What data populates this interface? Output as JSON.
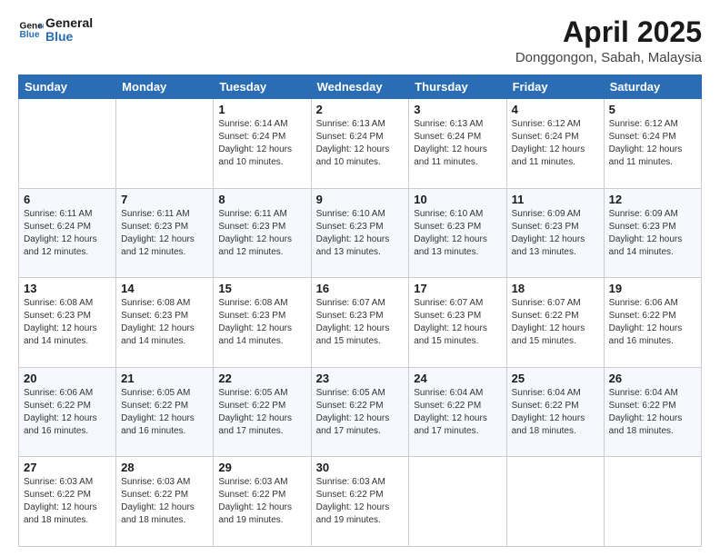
{
  "logo": {
    "line1": "General",
    "line2": "Blue"
  },
  "title": "April 2025",
  "subtitle": "Donggongon, Sabah, Malaysia",
  "weekdays": [
    "Sunday",
    "Monday",
    "Tuesday",
    "Wednesday",
    "Thursday",
    "Friday",
    "Saturday"
  ],
  "weeks": [
    [
      {
        "day": "",
        "info": ""
      },
      {
        "day": "",
        "info": ""
      },
      {
        "day": "1",
        "info": "Sunrise: 6:14 AM\nSunset: 6:24 PM\nDaylight: 12 hours and 10 minutes."
      },
      {
        "day": "2",
        "info": "Sunrise: 6:13 AM\nSunset: 6:24 PM\nDaylight: 12 hours and 10 minutes."
      },
      {
        "day": "3",
        "info": "Sunrise: 6:13 AM\nSunset: 6:24 PM\nDaylight: 12 hours and 11 minutes."
      },
      {
        "day": "4",
        "info": "Sunrise: 6:12 AM\nSunset: 6:24 PM\nDaylight: 12 hours and 11 minutes."
      },
      {
        "day": "5",
        "info": "Sunrise: 6:12 AM\nSunset: 6:24 PM\nDaylight: 12 hours and 11 minutes."
      }
    ],
    [
      {
        "day": "6",
        "info": "Sunrise: 6:11 AM\nSunset: 6:24 PM\nDaylight: 12 hours and 12 minutes."
      },
      {
        "day": "7",
        "info": "Sunrise: 6:11 AM\nSunset: 6:23 PM\nDaylight: 12 hours and 12 minutes."
      },
      {
        "day": "8",
        "info": "Sunrise: 6:11 AM\nSunset: 6:23 PM\nDaylight: 12 hours and 12 minutes."
      },
      {
        "day": "9",
        "info": "Sunrise: 6:10 AM\nSunset: 6:23 PM\nDaylight: 12 hours and 13 minutes."
      },
      {
        "day": "10",
        "info": "Sunrise: 6:10 AM\nSunset: 6:23 PM\nDaylight: 12 hours and 13 minutes."
      },
      {
        "day": "11",
        "info": "Sunrise: 6:09 AM\nSunset: 6:23 PM\nDaylight: 12 hours and 13 minutes."
      },
      {
        "day": "12",
        "info": "Sunrise: 6:09 AM\nSunset: 6:23 PM\nDaylight: 12 hours and 14 minutes."
      }
    ],
    [
      {
        "day": "13",
        "info": "Sunrise: 6:08 AM\nSunset: 6:23 PM\nDaylight: 12 hours and 14 minutes."
      },
      {
        "day": "14",
        "info": "Sunrise: 6:08 AM\nSunset: 6:23 PM\nDaylight: 12 hours and 14 minutes."
      },
      {
        "day": "15",
        "info": "Sunrise: 6:08 AM\nSunset: 6:23 PM\nDaylight: 12 hours and 14 minutes."
      },
      {
        "day": "16",
        "info": "Sunrise: 6:07 AM\nSunset: 6:23 PM\nDaylight: 12 hours and 15 minutes."
      },
      {
        "day": "17",
        "info": "Sunrise: 6:07 AM\nSunset: 6:23 PM\nDaylight: 12 hours and 15 minutes."
      },
      {
        "day": "18",
        "info": "Sunrise: 6:07 AM\nSunset: 6:22 PM\nDaylight: 12 hours and 15 minutes."
      },
      {
        "day": "19",
        "info": "Sunrise: 6:06 AM\nSunset: 6:22 PM\nDaylight: 12 hours and 16 minutes."
      }
    ],
    [
      {
        "day": "20",
        "info": "Sunrise: 6:06 AM\nSunset: 6:22 PM\nDaylight: 12 hours and 16 minutes."
      },
      {
        "day": "21",
        "info": "Sunrise: 6:05 AM\nSunset: 6:22 PM\nDaylight: 12 hours and 16 minutes."
      },
      {
        "day": "22",
        "info": "Sunrise: 6:05 AM\nSunset: 6:22 PM\nDaylight: 12 hours and 17 minutes."
      },
      {
        "day": "23",
        "info": "Sunrise: 6:05 AM\nSunset: 6:22 PM\nDaylight: 12 hours and 17 minutes."
      },
      {
        "day": "24",
        "info": "Sunrise: 6:04 AM\nSunset: 6:22 PM\nDaylight: 12 hours and 17 minutes."
      },
      {
        "day": "25",
        "info": "Sunrise: 6:04 AM\nSunset: 6:22 PM\nDaylight: 12 hours and 18 minutes."
      },
      {
        "day": "26",
        "info": "Sunrise: 6:04 AM\nSunset: 6:22 PM\nDaylight: 12 hours and 18 minutes."
      }
    ],
    [
      {
        "day": "27",
        "info": "Sunrise: 6:03 AM\nSunset: 6:22 PM\nDaylight: 12 hours and 18 minutes."
      },
      {
        "day": "28",
        "info": "Sunrise: 6:03 AM\nSunset: 6:22 PM\nDaylight: 12 hours and 18 minutes."
      },
      {
        "day": "29",
        "info": "Sunrise: 6:03 AM\nSunset: 6:22 PM\nDaylight: 12 hours and 19 minutes."
      },
      {
        "day": "30",
        "info": "Sunrise: 6:03 AM\nSunset: 6:22 PM\nDaylight: 12 hours and 19 minutes."
      },
      {
        "day": "",
        "info": ""
      },
      {
        "day": "",
        "info": ""
      },
      {
        "day": "",
        "info": ""
      }
    ]
  ]
}
